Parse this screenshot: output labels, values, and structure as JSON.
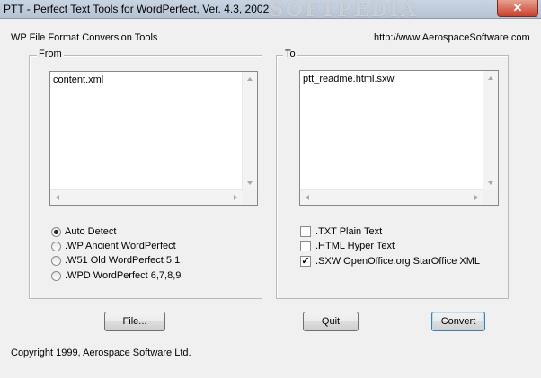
{
  "window": {
    "title": "PTT - Perfect Text Tools for WordPerfect, Ver. 4.3, 2002",
    "watermark": "SOFTPEDIA",
    "close_glyph": "✕"
  },
  "header": {
    "heading": "WP File Format Conversion Tools",
    "url": "http://www.AerospaceSoftware.com"
  },
  "from_group": {
    "label": "From",
    "list_items": [
      "content.xml"
    ],
    "options": [
      {
        "label": "Auto Detect",
        "selected": true
      },
      {
        "label": ".WP Ancient WordPerfect",
        "selected": false
      },
      {
        "label": ".W51 Old WordPerfect 5.1",
        "selected": false
      },
      {
        "label": ".WPD WordPerfect 6,7,8,9",
        "selected": false
      }
    ]
  },
  "to_group": {
    "label": "To",
    "list_items": [
      "ptt_readme.html.sxw"
    ],
    "options": [
      {
        "label": ".TXT Plain Text",
        "checked": false
      },
      {
        "label": ".HTML Hyper Text",
        "checked": false
      },
      {
        "label": ".SXW OpenOffice.org  StarOffice XML",
        "checked": true
      }
    ]
  },
  "buttons": {
    "file": "File...",
    "quit": "Quit",
    "convert": "Convert"
  },
  "footer": {
    "copyright": "Copyright 1999, Aerospace Software Ltd."
  },
  "icons": {
    "check_glyph": "✓"
  },
  "colors": {
    "face": "#f0f0f0",
    "titlebar": "#b6c3d4",
    "close": "#c7422d"
  }
}
